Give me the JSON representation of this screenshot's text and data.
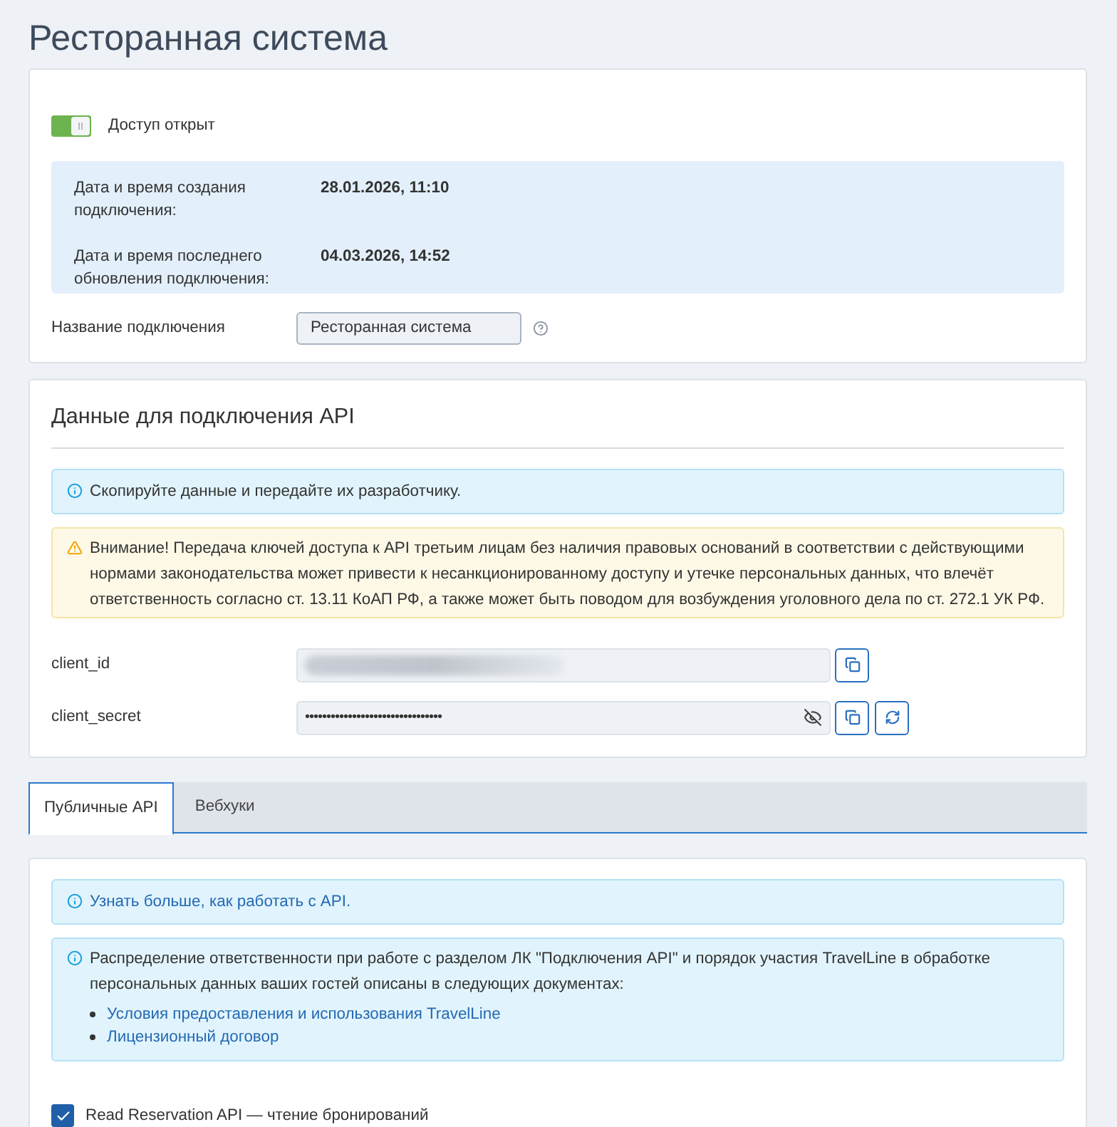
{
  "page": {
    "title": "Ресторанная система"
  },
  "connection": {
    "access": {
      "label": "Доступ открыт",
      "on": true
    },
    "dates": [
      {
        "label": "Дата и время создания подключения:",
        "value": "28.01.2026, 11:10"
      },
      {
        "label": "Дата и время последнего обновления подключения:",
        "value": "04.03.2026, 14:52"
      }
    ],
    "name_field": {
      "label": "Название подключения",
      "value": "Ресторанная система"
    }
  },
  "api_credentials": {
    "title": "Данные для подключения API",
    "alerts": [
      {
        "kind": "info",
        "text": "Скопируйте данные и передайте их разработчику."
      },
      {
        "kind": "warning",
        "text": "Внимание! Передача ключей доступа к API третьим лицам без наличия правовых оснований в соответствии с действующими нормами законодательства может привести к несанкционированному доступу и утечке персональных данных, что влечёт ответственность согласно ст. 13.11 КоАП РФ, а также может быть поводом для возбуждения уголовного дела по ст. 272.1 УК РФ."
      }
    ],
    "fields": [
      {
        "label": "client_id",
        "kind": "blurred",
        "actions": [
          {
            "kind": "copy"
          }
        ]
      },
      {
        "label": "client_secret",
        "kind": "masked",
        "value": "••••••••••••••••••••••••••••••••",
        "revealed": false,
        "actions": [
          {
            "kind": "copy"
          },
          {
            "kind": "regenerate"
          }
        ]
      }
    ]
  },
  "tabs": [
    {
      "label": "Публичные API",
      "selected": true
    },
    {
      "label": "Вебхуки",
      "selected": false
    }
  ],
  "public_api": {
    "alerts": [
      {
        "kind": "info",
        "link": "Узнать больше, как работать с API."
      },
      {
        "kind": "info",
        "text": "Распределение ответственности при работе с разделом ЛК \"Подключения API\" и порядок участия TravelLine в обработке персональных данных ваших гостей описаны в следующих документах:",
        "links": [
          "Условия предоставления и использования TravelLine",
          "Лицензионный договор"
        ]
      }
    ],
    "permissions": [
      {
        "label": "Read Reservation API — чтение бронирований",
        "checked": true
      }
    ]
  }
}
